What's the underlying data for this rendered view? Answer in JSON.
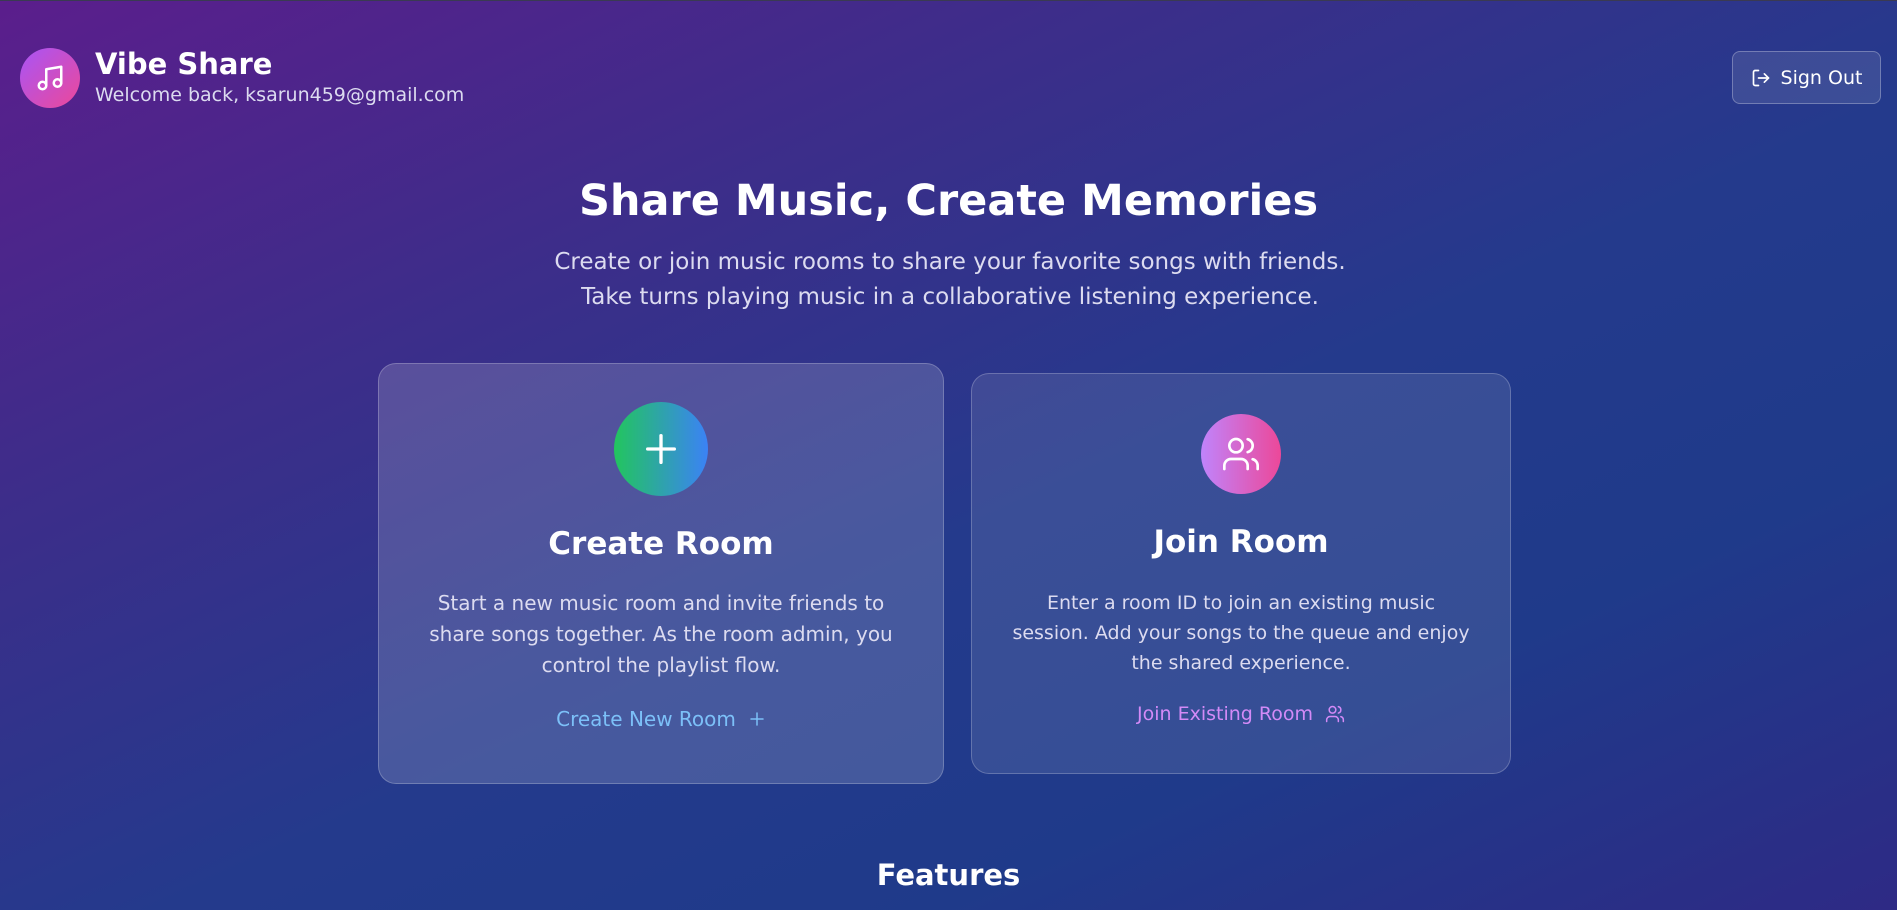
{
  "app": {
    "name": "Vibe Share",
    "welcome": "Welcome back, ksarun459@gmail.com",
    "logo_icon": "music-note-icon"
  },
  "header": {
    "sign_out_label": "Sign Out",
    "sign_out_icon": "log-out-icon"
  },
  "hero": {
    "title": "Share Music, Create Memories",
    "subtitle": "Create or join music rooms to share your favorite songs with friends. Take turns playing music in a collaborative listening experience."
  },
  "cards": {
    "create": {
      "icon": "plus-icon",
      "title": "Create Room",
      "description": "Start a new music room and invite friends to share songs together. As the room admin, you control the playlist flow.",
      "action_label": "Create New Room",
      "accent": "#7cc0f8"
    },
    "join": {
      "icon": "users-icon",
      "title": "Join Room",
      "description": "Enter a room ID to join an existing music session. Add your songs to the queue and enjoy the shared experience.",
      "action_label": "Join Existing Room",
      "accent": "#d38af7"
    }
  },
  "sections": {
    "features_title": "Features"
  }
}
